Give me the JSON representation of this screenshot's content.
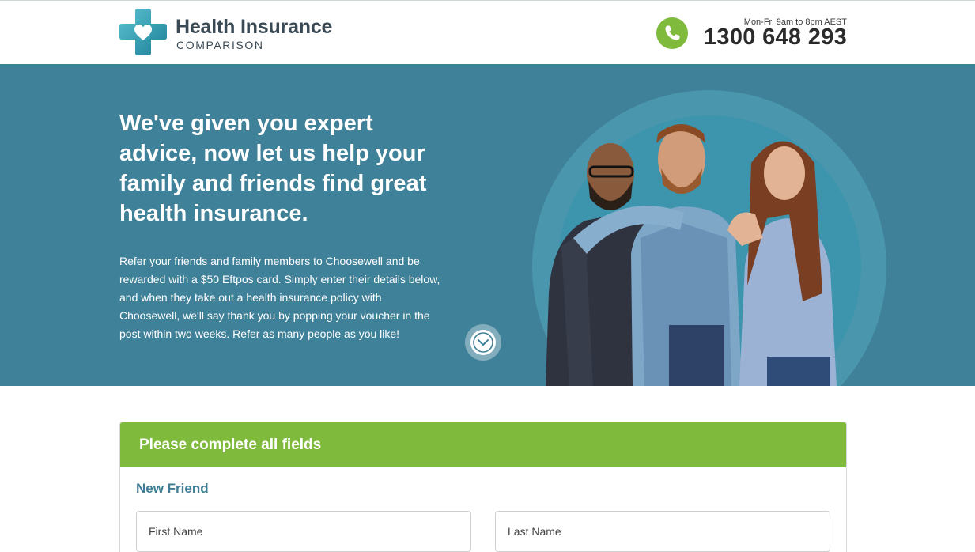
{
  "header": {
    "logo_title": "Health Insurance",
    "logo_subtitle": "COMPARISON",
    "phone_hours": "Mon-Fri 9am to 8pm AEST",
    "phone_number": "1300 648 293"
  },
  "hero": {
    "heading_plain": "We've given you expert advice, now let us help your family and friends ",
    "heading_bold": "find great health insurance.",
    "body": "Refer your friends and family members to Choosewell and be rewarded with a $50 Eftpos card. Simply enter their details below, and when they take out a health insurance policy with Choosewell, we'll say thank you by popping your voucher in the post within two weeks. Refer as many people as you like!"
  },
  "form": {
    "header": "Please complete all fields",
    "section_title": "New Friend",
    "first_name_placeholder": "First Name",
    "last_name_placeholder": "Last Name"
  },
  "icons": {
    "logo": "cross-heart-logo-icon",
    "phone": "phone-icon",
    "scroll": "chevron-down-icon"
  },
  "colors": {
    "hero_bg": "#3f8199",
    "accent_green": "#7fba3d",
    "logo_teal": "#3aa3b8",
    "section_title": "#3f7d95"
  }
}
